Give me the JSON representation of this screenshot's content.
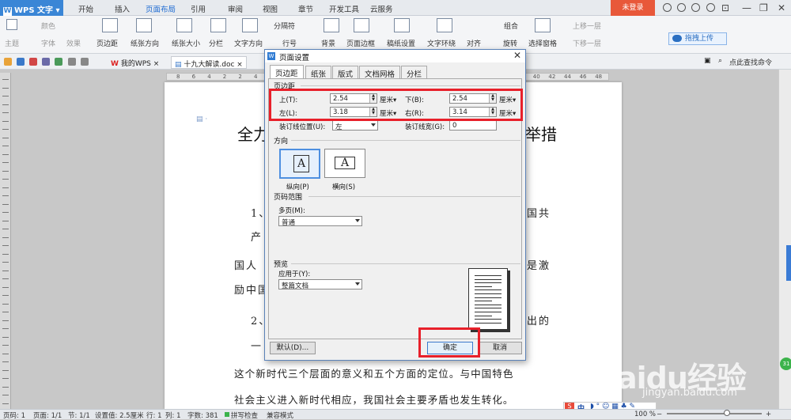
{
  "app": {
    "name": "WPS 文字",
    "logo": "W"
  },
  "menu_tabs": [
    "开始",
    "插入",
    "页面布局",
    "引用",
    "审阅",
    "视图",
    "章节",
    "开发工具",
    "云服务"
  ],
  "active_tab": "页面布局",
  "login_label": "未登录",
  "ribbon": {
    "theme": "主题",
    "color": "颜色",
    "font": "字体",
    "effect": "效果",
    "margin": "页边距",
    "orientation": "纸张方向",
    "size": "纸张大小",
    "columns": "分栏",
    "text_direction": "文字方向",
    "breaks": "分隔符",
    "line_number": "行号",
    "background": "背景",
    "page_border": "页面边框",
    "draft_paper": "稿纸设置",
    "text_wrap": "文字环绕",
    "align": "对齐",
    "group": "组合",
    "rotate": "旋转",
    "select_pane": "选择窗格",
    "bring_forward": "上移一层",
    "send_backward": "下移一层",
    "cloud_upload": "拖拽上传"
  },
  "doc_tabs": [
    {
      "label": "我的WPS"
    },
    {
      "label": "十九大解读.doc"
    }
  ],
  "search_command": "点此查找命令",
  "ruler_ticks": [
    "8",
    "6",
    "4",
    "2",
    "2",
    "4",
    "6",
    "8",
    "10",
    "12",
    "14",
    "16",
    "18",
    "20",
    "22",
    "24",
    "26",
    "28",
    "30",
    "32",
    "34",
    "36",
    "38",
    "40",
    "42",
    "44",
    "46",
    "48"
  ],
  "document": {
    "title_left": "全力",
    "title_right": "举措",
    "lines": [
      {
        "left": "1、",
        "right": "国共"
      },
      {
        "left": "产"
      },
      {
        "left": "国人",
        "right": "是激"
      },
      {
        "left": "励中国"
      },
      {
        "left": "2、",
        "right": "出的"
      },
      {
        "left": "一"
      },
      {
        "full": "这个新时代三个层面的意义和五个方面的定位。与中国特色"
      },
      {
        "full": "社会主义进入新时代相应，我国社会主要矛盾也发生转化。"
      }
    ]
  },
  "dialog": {
    "title": "页面设置",
    "tabs": [
      "页边距",
      "纸张",
      "版式",
      "文档网格",
      "分栏"
    ],
    "active_tab": "页边距",
    "margins_section": "页边距",
    "top_label": "上(T):",
    "top_value": "2.54",
    "bottom_label": "下(B):",
    "bottom_value": "2.54",
    "left_label": "左(L):",
    "left_value": "3.18",
    "right_label": "右(R):",
    "right_value": "3.14",
    "unit": "厘米",
    "gutter_pos_label": "装订线位置(U):",
    "gutter_pos_value": "左",
    "gutter_width_label": "装订线宽(G):",
    "gutter_width_value": "0",
    "orientation_section": "方向",
    "portrait_label": "纵向(P)",
    "landscape_label": "横向(S)",
    "page_range_section": "页码范围",
    "multiple_pages_label": "多页(M):",
    "multiple_pages_value": "普通",
    "preview_section": "预览",
    "apply_to_label": "应用于(Y):",
    "apply_to_value": "整篇文档",
    "default_button": "默认(D)...",
    "ok_button": "确定",
    "cancel_button": "取消"
  },
  "status": {
    "page_code": "页码: 1",
    "page": "页面: 1/1",
    "section": "节: 1/1",
    "setting": "设置值: 2.5厘米",
    "row": "行: 1",
    "col": "列: 1",
    "chars": "字数: 381",
    "spell": "拼写检查",
    "compat": "兼容模式",
    "zoom": "100 %"
  },
  "ime": "中",
  "watermark": {
    "main": "Baidu经验",
    "sub": "jingyan.baidu.com"
  },
  "badge": "31",
  "colors": {
    "accent": "#1d6ad2",
    "login": "#e8583a",
    "highlight": "#e8202a"
  }
}
